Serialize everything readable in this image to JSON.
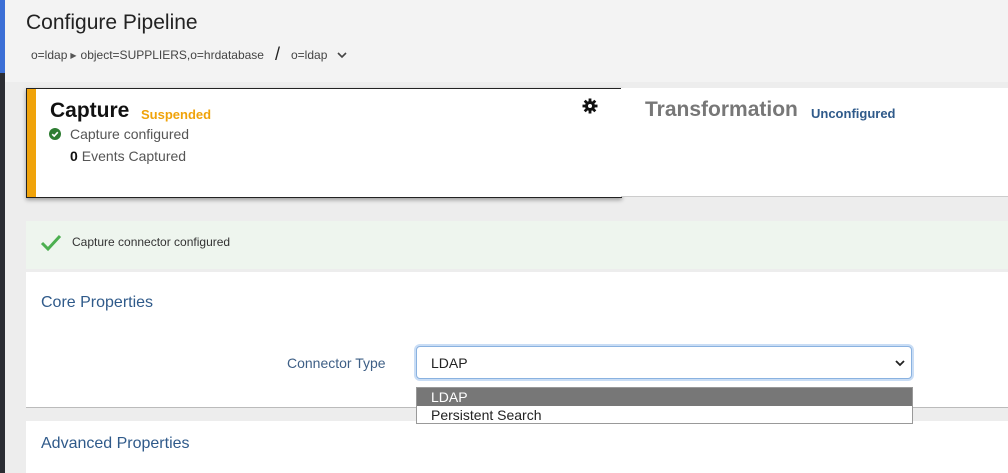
{
  "header": {
    "title": "Configure Pipeline",
    "breadcrumb": {
      "part1": "o=ldap",
      "part2": "object=SUPPLIERS,o=hrdatabase",
      "part3": "o=ldap"
    }
  },
  "capture_card": {
    "title": "Capture",
    "status": "Suspended",
    "configured_text": "Capture configured",
    "events_count": "0",
    "events_label": "Events Captured"
  },
  "transformation_card": {
    "title": "Transformation",
    "status": "Unconfigured"
  },
  "alert": {
    "message": "Capture connector configured"
  },
  "core_properties": {
    "title": "Core Properties",
    "connector_type_label": "Connector Type",
    "connector_type_value": "LDAP",
    "options": [
      "LDAP",
      "Persistent Search"
    ]
  },
  "advanced_properties": {
    "title": "Advanced Properties"
  },
  "colors": {
    "suspended": "#f0a30a",
    "unconfigured": "#2f5a8a",
    "success": "#4caf50"
  }
}
